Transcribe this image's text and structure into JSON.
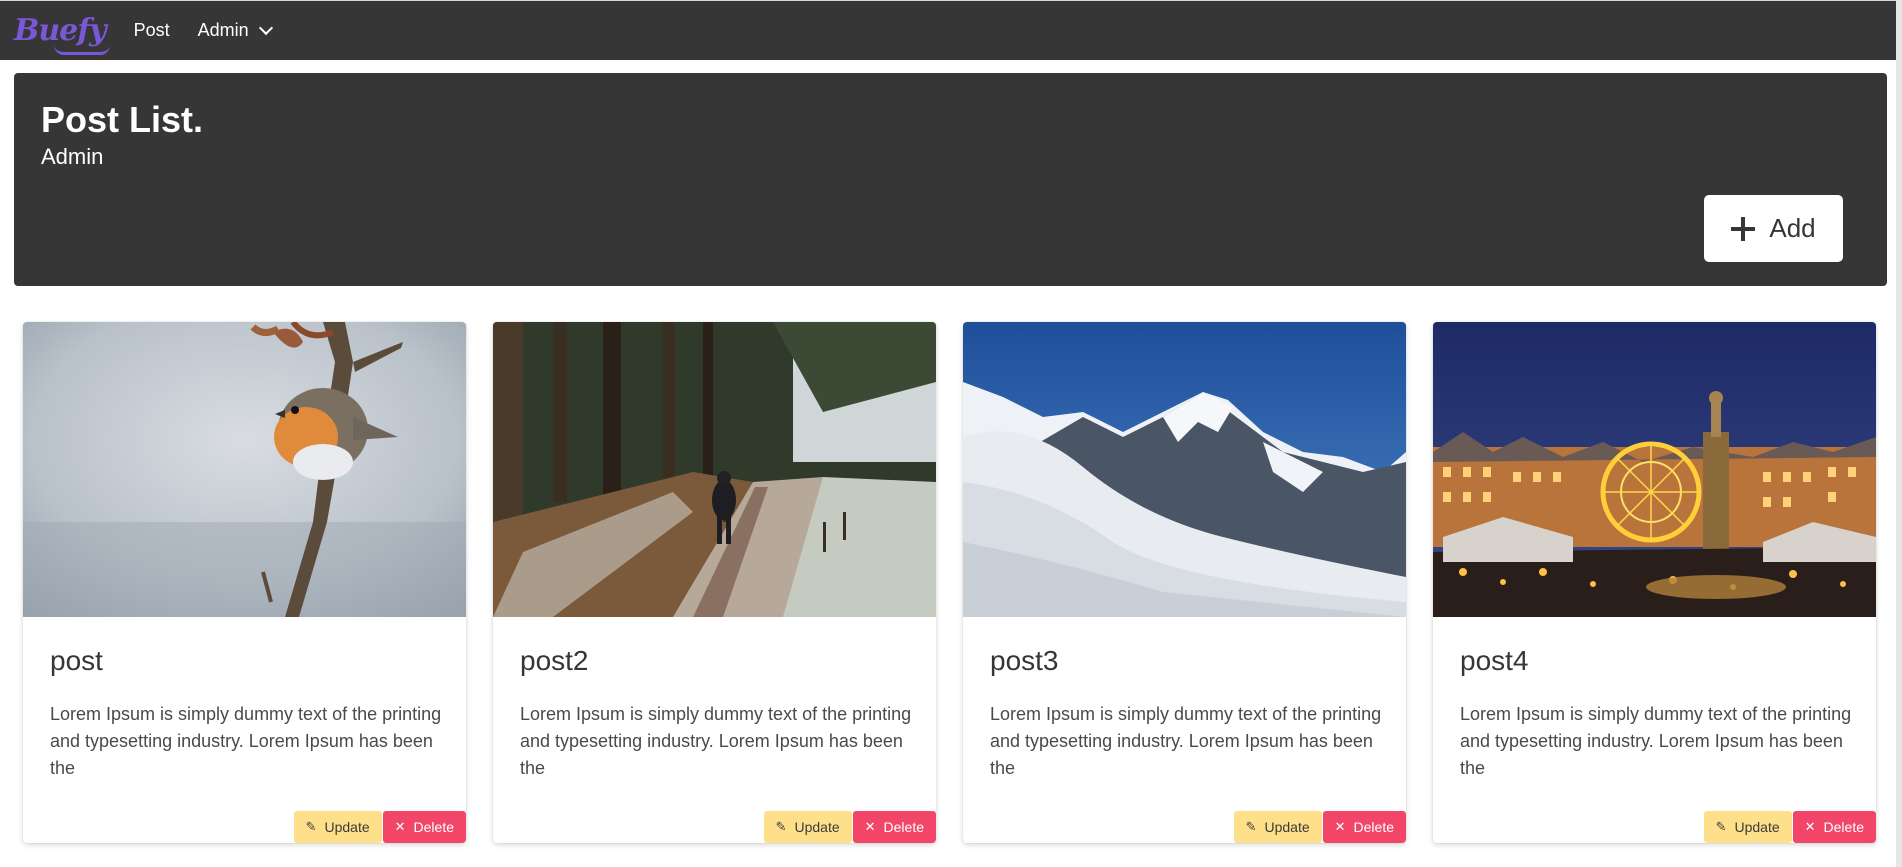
{
  "navbar": {
    "brand": "Buefy",
    "items": [
      {
        "label": "Post"
      },
      {
        "label": "Admin"
      }
    ]
  },
  "hero": {
    "title": "Post List.",
    "subtitle": "Admin",
    "add_label": "Add"
  },
  "posts": [
    {
      "title": "post",
      "text": "Lorem Ipsum is simply dummy text of the printing and typesetting industry. Lorem Ipsum has been the",
      "update_label": "Update",
      "delete_label": "Delete"
    },
    {
      "title": "post2",
      "text": "Lorem Ipsum is simply dummy text of the printing and typesetting industry. Lorem Ipsum has been the",
      "update_label": "Update",
      "delete_label": "Delete"
    },
    {
      "title": "post3",
      "text": "Lorem Ipsum is simply dummy text of the printing and typesetting industry. Lorem Ipsum has been the",
      "update_label": "Update",
      "delete_label": "Delete"
    },
    {
      "title": "post4",
      "text": "Lorem Ipsum is simply dummy text of the printing and typesetting industry. Lorem Ipsum has been the",
      "update_label": "Update",
      "delete_label": "Delete"
    }
  ],
  "icons": {
    "add": "plus-icon",
    "update": "pencil-icon",
    "delete": "close-icon",
    "dropdown": "chevron-down-icon"
  },
  "colors": {
    "navbar_bg": "#363636",
    "brand": "#7957d5",
    "update_button": "#ffe08a",
    "delete_button": "#f14668"
  }
}
